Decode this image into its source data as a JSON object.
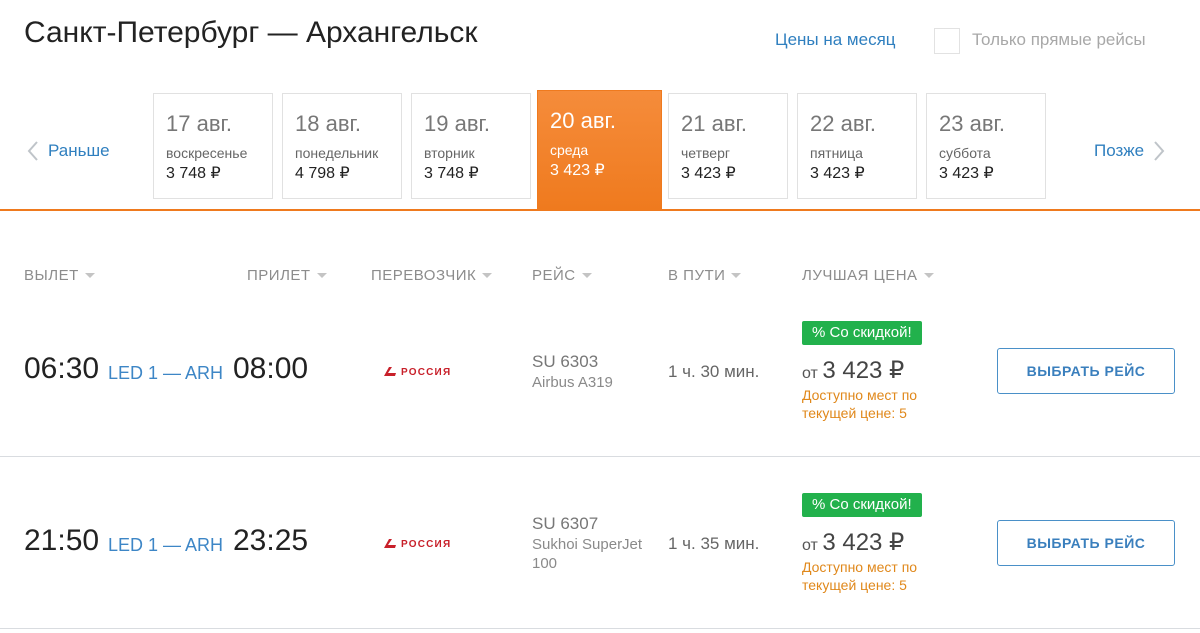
{
  "header": {
    "route_title": "Санкт-Петербург — Архангельск",
    "month_prices_link": "Цены на месяц",
    "direct_only_label": "Только прямые рейсы"
  },
  "carousel": {
    "prev_label": "Раньше",
    "next_label": "Позже",
    "dates": [
      {
        "date": "17 авг.",
        "day": "воскресенье",
        "price": "3 748 ₽",
        "active": false
      },
      {
        "date": "18 авг.",
        "day": "понедельник",
        "price": "4 798 ₽",
        "active": false
      },
      {
        "date": "19 авг.",
        "day": "вторник",
        "price": "3 748 ₽",
        "active": false
      },
      {
        "date": "20 авг.",
        "day": "среда",
        "price": "3 423 ₽",
        "active": true
      },
      {
        "date": "21 авг.",
        "day": "четверг",
        "price": "3 423 ₽",
        "active": false
      },
      {
        "date": "22 авг.",
        "day": "пятница",
        "price": "3 423 ₽",
        "active": false
      },
      {
        "date": "23 авг.",
        "day": "суббота",
        "price": "3 423 ₽",
        "active": false
      }
    ]
  },
  "columns": {
    "departure": "ВЫЛЕТ",
    "arrival": "ПРИЛЕТ",
    "carrier": "ПЕРЕВОЗЧИК",
    "flight": "РЕЙС",
    "duration": "В ПУТИ",
    "best_price": "ЛУЧШАЯ ЦЕНА"
  },
  "flights": [
    {
      "dep_time": "06:30",
      "airports": "LED 1 — ARH",
      "arr_time": "08:00",
      "carrier_brand": "РОССИЯ",
      "flight_no": "SU 6303",
      "aircraft": "Airbus A319",
      "duration": "1 ч. 30 мин.",
      "badge": "% Со скидкой!",
      "price_prefix": "от",
      "price": "3 423 ₽",
      "seats_note": "Доступно мест по текущей цене: 5",
      "button": "ВЫБРАТЬ РЕЙС"
    },
    {
      "dep_time": "21:50",
      "airports": "LED 1 — ARH",
      "arr_time": "23:25",
      "carrier_brand": "РОССИЯ",
      "flight_no": "SU 6307",
      "aircraft": "Sukhoi SuperJet 100",
      "duration": "1 ч. 35 мин.",
      "badge": "% Со скидкой!",
      "price_prefix": "от",
      "price": "3 423 ₽",
      "seats_note": "Доступно мест по текущей цене: 5",
      "button": "ВЫБРАТЬ РЕЙС"
    }
  ],
  "colors": {
    "accent_orange": "#ef7a1e",
    "link_blue": "#2f7fbf",
    "discount_green": "#22b14c",
    "seats_orange": "#e0881b",
    "carrier_red": "#c8202a"
  }
}
